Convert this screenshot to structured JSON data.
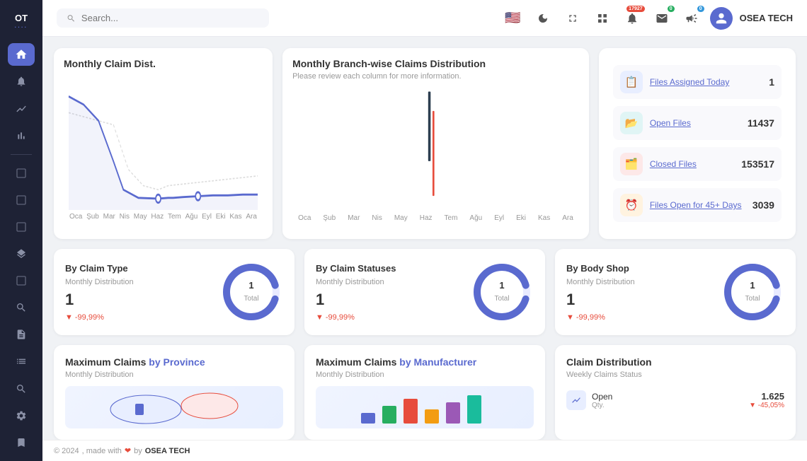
{
  "logo": {
    "line1": "OT",
    "line2": "...."
  },
  "header": {
    "search_placeholder": "Search...",
    "user_name": "OSEA TECH",
    "notification_badge": "17927",
    "mail_badge": "0",
    "megaphone_badge": "0"
  },
  "stats": {
    "items": [
      {
        "id": "files-assigned-today",
        "label": "Files Assigned Today",
        "value": "1",
        "icon": "📋",
        "icon_class": "blue"
      },
      {
        "id": "open-files",
        "label": "Open Files",
        "value": "11437",
        "icon": "📂",
        "icon_class": "teal"
      },
      {
        "id": "closed-files",
        "label": "Closed Files",
        "value": "153517",
        "icon": "🗂️",
        "icon_class": "red"
      },
      {
        "id": "files-open-45",
        "label": "Files Open for 45+ Days",
        "value": "3039",
        "icon": "⏰",
        "icon_class": "orange"
      }
    ]
  },
  "monthly_claim": {
    "title": "Monthly Claim Dist.",
    "months": [
      "Oca",
      "Şub",
      "Mar",
      "Nis",
      "May",
      "Haz",
      "Tem",
      "Ağu",
      "Eyl",
      "Eki",
      "Kas",
      "Ara"
    ]
  },
  "branch_claims": {
    "title": "Monthly Branch-wise Claims Distribution",
    "subtitle": "Please review each column for more information.",
    "months": [
      "Oca",
      "Şub",
      "Mar",
      "Nis",
      "May",
      "Haz",
      "Tem",
      "Ağu",
      "Eyl",
      "Eki",
      "Kas",
      "Ara"
    ]
  },
  "metric_cards": [
    {
      "title": "By Claim Type",
      "subtitle": "Monthly Distribution",
      "value": "1",
      "change": "-99,99%",
      "donut_label": "1",
      "donut_sub": "Total"
    },
    {
      "title": "By Claim Statuses",
      "subtitle": "Monthly Distribution",
      "value": "1",
      "change": "-99,99%",
      "donut_label": "1",
      "donut_sub": "Total"
    },
    {
      "title": "By Body Shop",
      "subtitle": "Monthly Distribution",
      "value": "1",
      "change": "-99,99%",
      "donut_label": "1",
      "donut_sub": "Total"
    }
  ],
  "map_cards": [
    {
      "title": "Maximum Claims",
      "title_highlight": "by Province",
      "subtitle": "Monthly Distribution"
    },
    {
      "title": "Maximum Claims",
      "title_highlight": "by Manufacturer",
      "subtitle": "Monthly Distribution"
    }
  ],
  "claim_distribution": {
    "title": "Claim Distribution",
    "subtitle": "Weekly Claims Status",
    "items": [
      {
        "label": "Open",
        "sub": "Qty.",
        "value": "1.625",
        "change": "▼ -45,05%",
        "icon": "📈",
        "icon_class": "blue"
      }
    ]
  },
  "footer": {
    "year": "© 2024",
    "made_by": "OSEA TECH",
    "made_text": ", made with"
  },
  "sidebar": {
    "icons": [
      {
        "name": "home",
        "symbol": "⊞",
        "active": true
      },
      {
        "name": "bell",
        "symbol": "🔔",
        "active": false
      },
      {
        "name": "chart-line",
        "symbol": "📈",
        "active": false
      },
      {
        "name": "bar-chart",
        "symbol": "📊",
        "active": false
      },
      {
        "name": "minus",
        "symbol": "—",
        "active": false
      },
      {
        "name": "square1",
        "symbol": "▭",
        "active": false
      },
      {
        "name": "square2",
        "symbol": "▭",
        "active": false
      },
      {
        "name": "square3",
        "symbol": "▭",
        "active": false
      },
      {
        "name": "layers",
        "symbol": "❏",
        "active": false
      },
      {
        "name": "square4",
        "symbol": "▭",
        "active": false
      },
      {
        "name": "search",
        "symbol": "🔍",
        "active": false
      },
      {
        "name": "file",
        "symbol": "📄",
        "active": false
      },
      {
        "name": "list",
        "symbol": "☰",
        "active": false
      },
      {
        "name": "search2",
        "symbol": "🔎",
        "active": false
      },
      {
        "name": "gear",
        "symbol": "⚙",
        "active": false
      },
      {
        "name": "bookmark",
        "symbol": "🔖",
        "active": false
      }
    ]
  }
}
